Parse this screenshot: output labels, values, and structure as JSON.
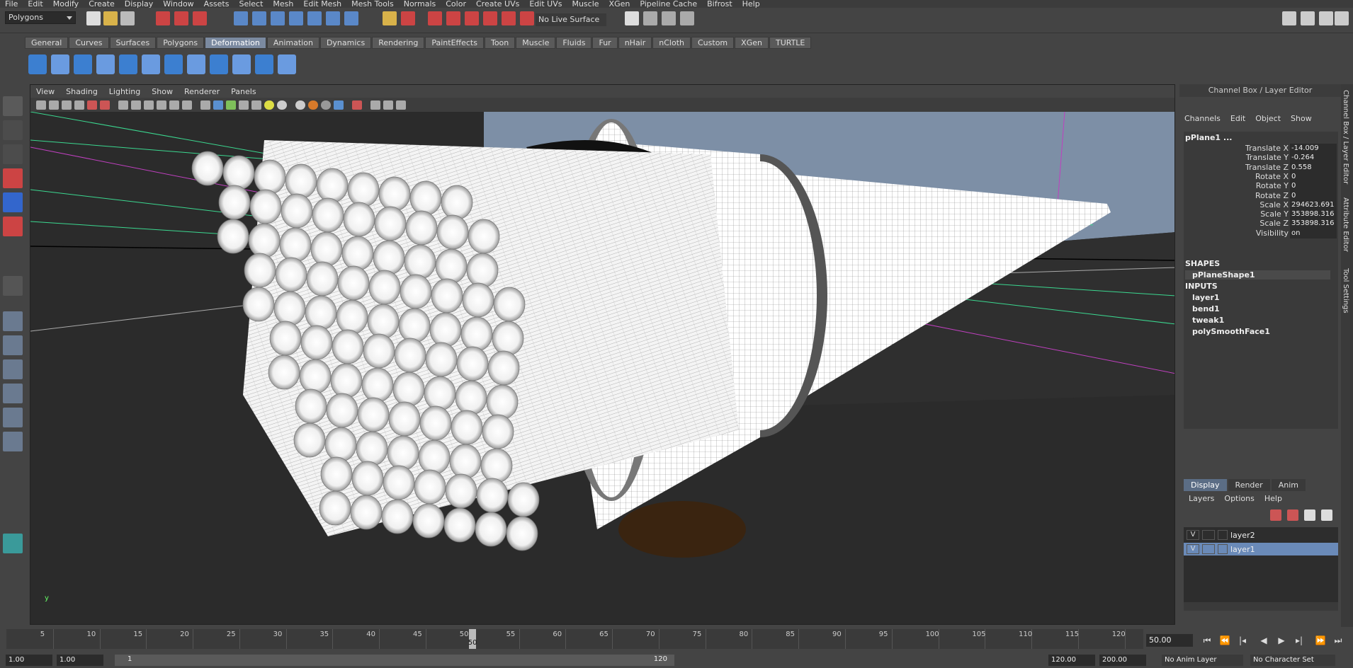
{
  "menubar": [
    "File",
    "Edit",
    "Modify",
    "Create",
    "Display",
    "Window",
    "Assets",
    "Select",
    "Mesh",
    "Edit Mesh",
    "Mesh Tools",
    "Normals",
    "Color",
    "Create UVs",
    "Edit UVs",
    "Muscle",
    "XGen",
    "Pipeline Cache",
    "Bifrost",
    "Help"
  ],
  "statusline": {
    "mode": "Polygons",
    "live_surface": "No Live Surface"
  },
  "shelf": {
    "tabs": [
      "General",
      "Curves",
      "Surfaces",
      "Polygons",
      "Deformation",
      "Animation",
      "Dynamics",
      "Rendering",
      "PaintEffects",
      "Toon",
      "Muscle",
      "Fluids",
      "Fur",
      "nHair",
      "nCloth",
      "Custom",
      "XGen",
      "TURTLE"
    ],
    "active_tab": "Deformation"
  },
  "viewport": {
    "menu": [
      "View",
      "Shading",
      "Lighting",
      "Show",
      "Renderer",
      "Panels"
    ],
    "axis_label": "y"
  },
  "channel_box": {
    "title": "Channel Box / Layer Editor",
    "menu": [
      "Channels",
      "Edit",
      "Object",
      "Show"
    ],
    "object": "pPlane1 ...",
    "attributes": [
      {
        "name": "Translate X",
        "value": "-14.009"
      },
      {
        "name": "Translate Y",
        "value": "-0.264"
      },
      {
        "name": "Translate Z",
        "value": "0.558"
      },
      {
        "name": "Rotate X",
        "value": "0"
      },
      {
        "name": "Rotate Y",
        "value": "0"
      },
      {
        "name": "Rotate Z",
        "value": "0"
      },
      {
        "name": "Scale X",
        "value": "294623.691"
      },
      {
        "name": "Scale Y",
        "value": "353898.316"
      },
      {
        "name": "Scale Z",
        "value": "353898.316"
      },
      {
        "name": "Visibility",
        "value": "on"
      }
    ],
    "shapes_header": "SHAPES",
    "shapes": [
      "pPlaneShape1"
    ],
    "inputs_header": "INPUTS",
    "inputs": [
      "layer1",
      "bend1",
      "tweak1",
      "polySmoothFace1"
    ]
  },
  "layer_editor": {
    "tabs": [
      "Display",
      "Render",
      "Anim"
    ],
    "active_tab": "Display",
    "menu": [
      "Layers",
      "Options",
      "Help"
    ],
    "layers": [
      {
        "vis": "V",
        "name": "layer2",
        "selected": false
      },
      {
        "vis": "V",
        "name": "layer1",
        "selected": true
      }
    ]
  },
  "side_tabs": [
    "Channel Box / Layer Editor",
    "Attribute Editor",
    "Tool Settings"
  ],
  "time_slider": {
    "ticks": [
      "5",
      "10",
      "15",
      "20",
      "25",
      "30",
      "35",
      "40",
      "45",
      "50",
      "55",
      "60",
      "65",
      "70",
      "75",
      "80",
      "85",
      "90",
      "95",
      "100",
      "105",
      "110",
      "115",
      "120"
    ],
    "current_frame": "50",
    "current_frame_field": "50.00"
  },
  "range_slider": {
    "start": "1.00",
    "start2": "1.00",
    "range_start": "1",
    "range_end": "120",
    "end": "120.00",
    "end2": "200.00",
    "anim_layer": "No Anim Layer",
    "char_set": "No Character Set"
  }
}
